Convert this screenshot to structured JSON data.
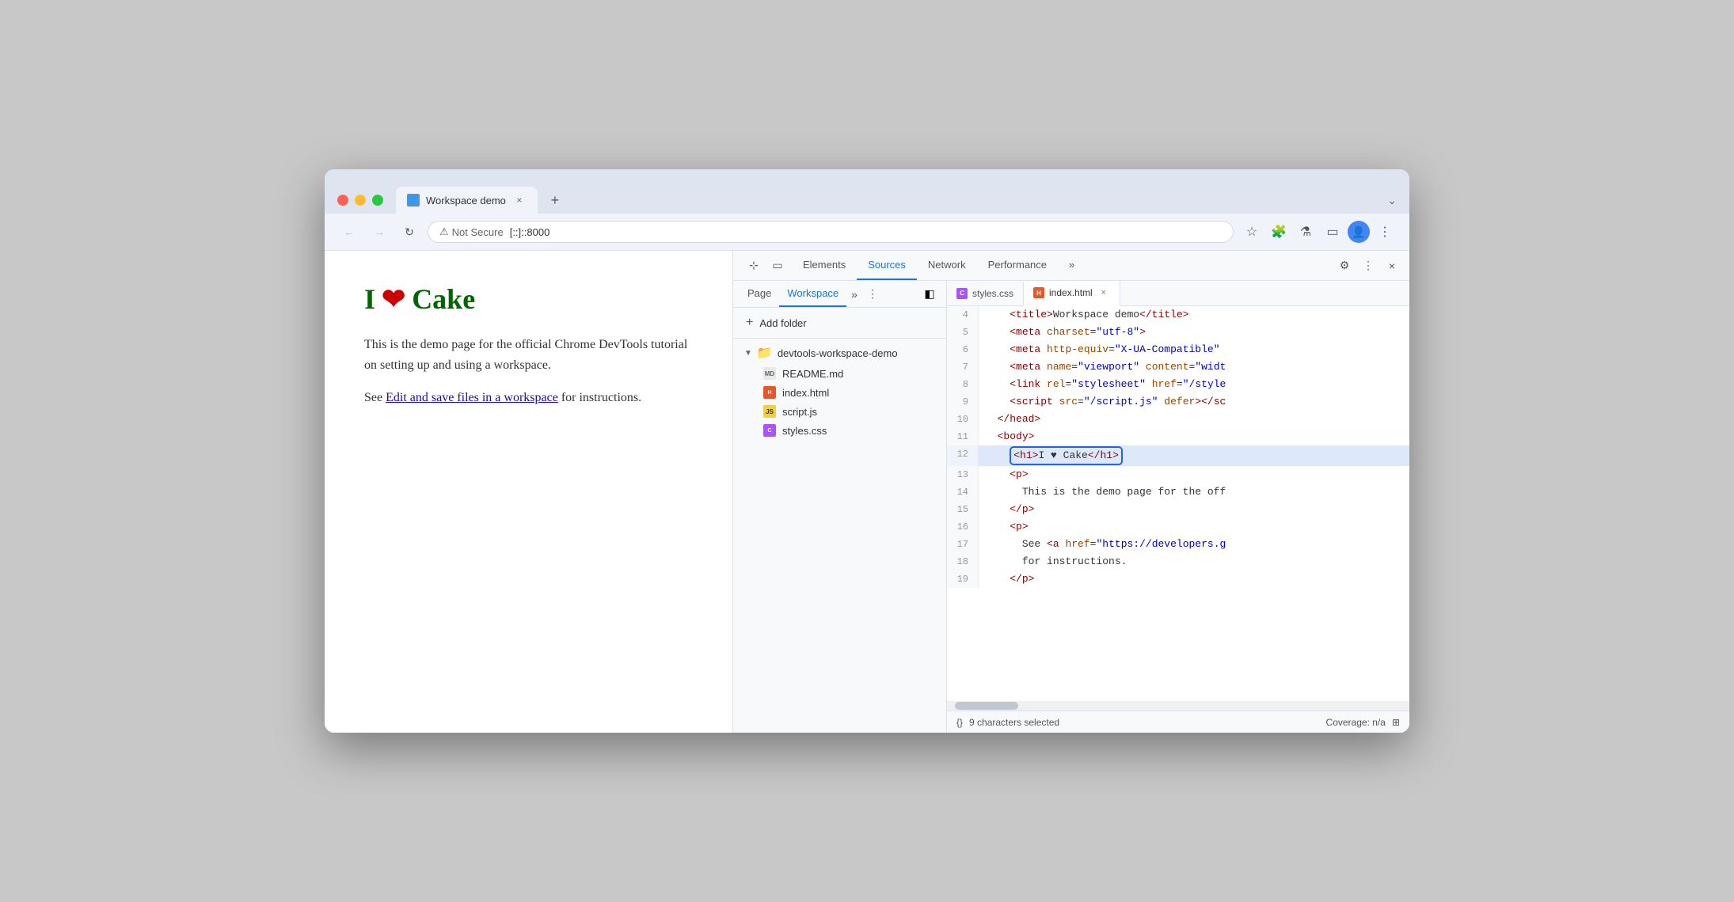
{
  "browser": {
    "tab_title": "Workspace demo",
    "tab_close_label": "×",
    "tab_new_label": "+",
    "tab_chevron_label": "⌄",
    "security_label": "Not Secure",
    "url": "[::]::8000",
    "back_btn": "←",
    "forward_btn": "→",
    "reload_btn": "↻"
  },
  "webpage": {
    "heading": "I ♥ Cake",
    "para1": "This is the demo page for the official Chrome DevTools tutorial on setting up and using a workspace.",
    "para2_prefix": "See ",
    "para2_link": "Edit and save files in a workspace",
    "para2_suffix": " for instructions."
  },
  "devtools": {
    "tabs": [
      "Elements",
      "Sources",
      "Network",
      "Performance"
    ],
    "active_tab": "Sources",
    "more_tabs_label": "»",
    "settings_icon": "⚙",
    "kebab_icon": "⋮",
    "close_icon": "×"
  },
  "sources": {
    "subtabs": [
      "Page",
      "Workspace"
    ],
    "active_subtab": "Workspace",
    "more_icon": "»",
    "kebab_icon": "⋮",
    "sidebar_icon": "◧",
    "add_folder_label": "Add folder",
    "folder_name": "devtools-workspace-demo",
    "files": [
      {
        "name": "README.md",
        "type": "md"
      },
      {
        "name": "index.html",
        "type": "html"
      },
      {
        "name": "script.js",
        "type": "js"
      },
      {
        "name": "styles.css",
        "type": "css"
      }
    ],
    "editor_tabs": [
      {
        "name": "styles.css",
        "type": "css",
        "active": false
      },
      {
        "name": "index.html",
        "type": "html",
        "active": true
      }
    ]
  },
  "code": {
    "lines": [
      {
        "num": "4",
        "content": "    <title>Workspace demo</title>",
        "highlighted": false
      },
      {
        "num": "5",
        "content": "    <meta charset=\"utf-8\">",
        "highlighted": false
      },
      {
        "num": "6",
        "content": "    <meta http-equiv=\"X-UA-Compatible\"",
        "highlighted": false,
        "truncated": true
      },
      {
        "num": "7",
        "content": "    <meta name=\"viewport\" content=\"widt",
        "highlighted": false,
        "truncated": true
      },
      {
        "num": "8",
        "content": "    <link rel=\"stylesheet\" href=\"/style",
        "highlighted": false,
        "truncated": true
      },
      {
        "num": "9",
        "content": "    <script src=\"/script.js\" defer></sc",
        "highlighted": false,
        "truncated": true
      },
      {
        "num": "10",
        "content": "  </head>",
        "highlighted": false
      },
      {
        "num": "11",
        "content": "  <body>",
        "highlighted": false
      },
      {
        "num": "12",
        "content": "    <h1>I ♥ Cake</h1>",
        "highlighted": true
      },
      {
        "num": "13",
        "content": "    <p>",
        "highlighted": false
      },
      {
        "num": "14",
        "content": "      This is the demo page for the off",
        "highlighted": false,
        "truncated": true
      },
      {
        "num": "15",
        "content": "    </p>",
        "highlighted": false
      },
      {
        "num": "16",
        "content": "    <p>",
        "highlighted": false
      },
      {
        "num": "17",
        "content": "      See <a href=\"https://developers.g",
        "highlighted": false,
        "truncated": true
      },
      {
        "num": "18",
        "content": "      for instructions.",
        "highlighted": false
      },
      {
        "num": "19",
        "content": "    </p>",
        "highlighted": false
      }
    ]
  },
  "status": {
    "format_icon": "{}",
    "selection_text": "9 characters selected",
    "coverage_label": "Coverage: n/a",
    "screenshot_icon": "⊞"
  }
}
